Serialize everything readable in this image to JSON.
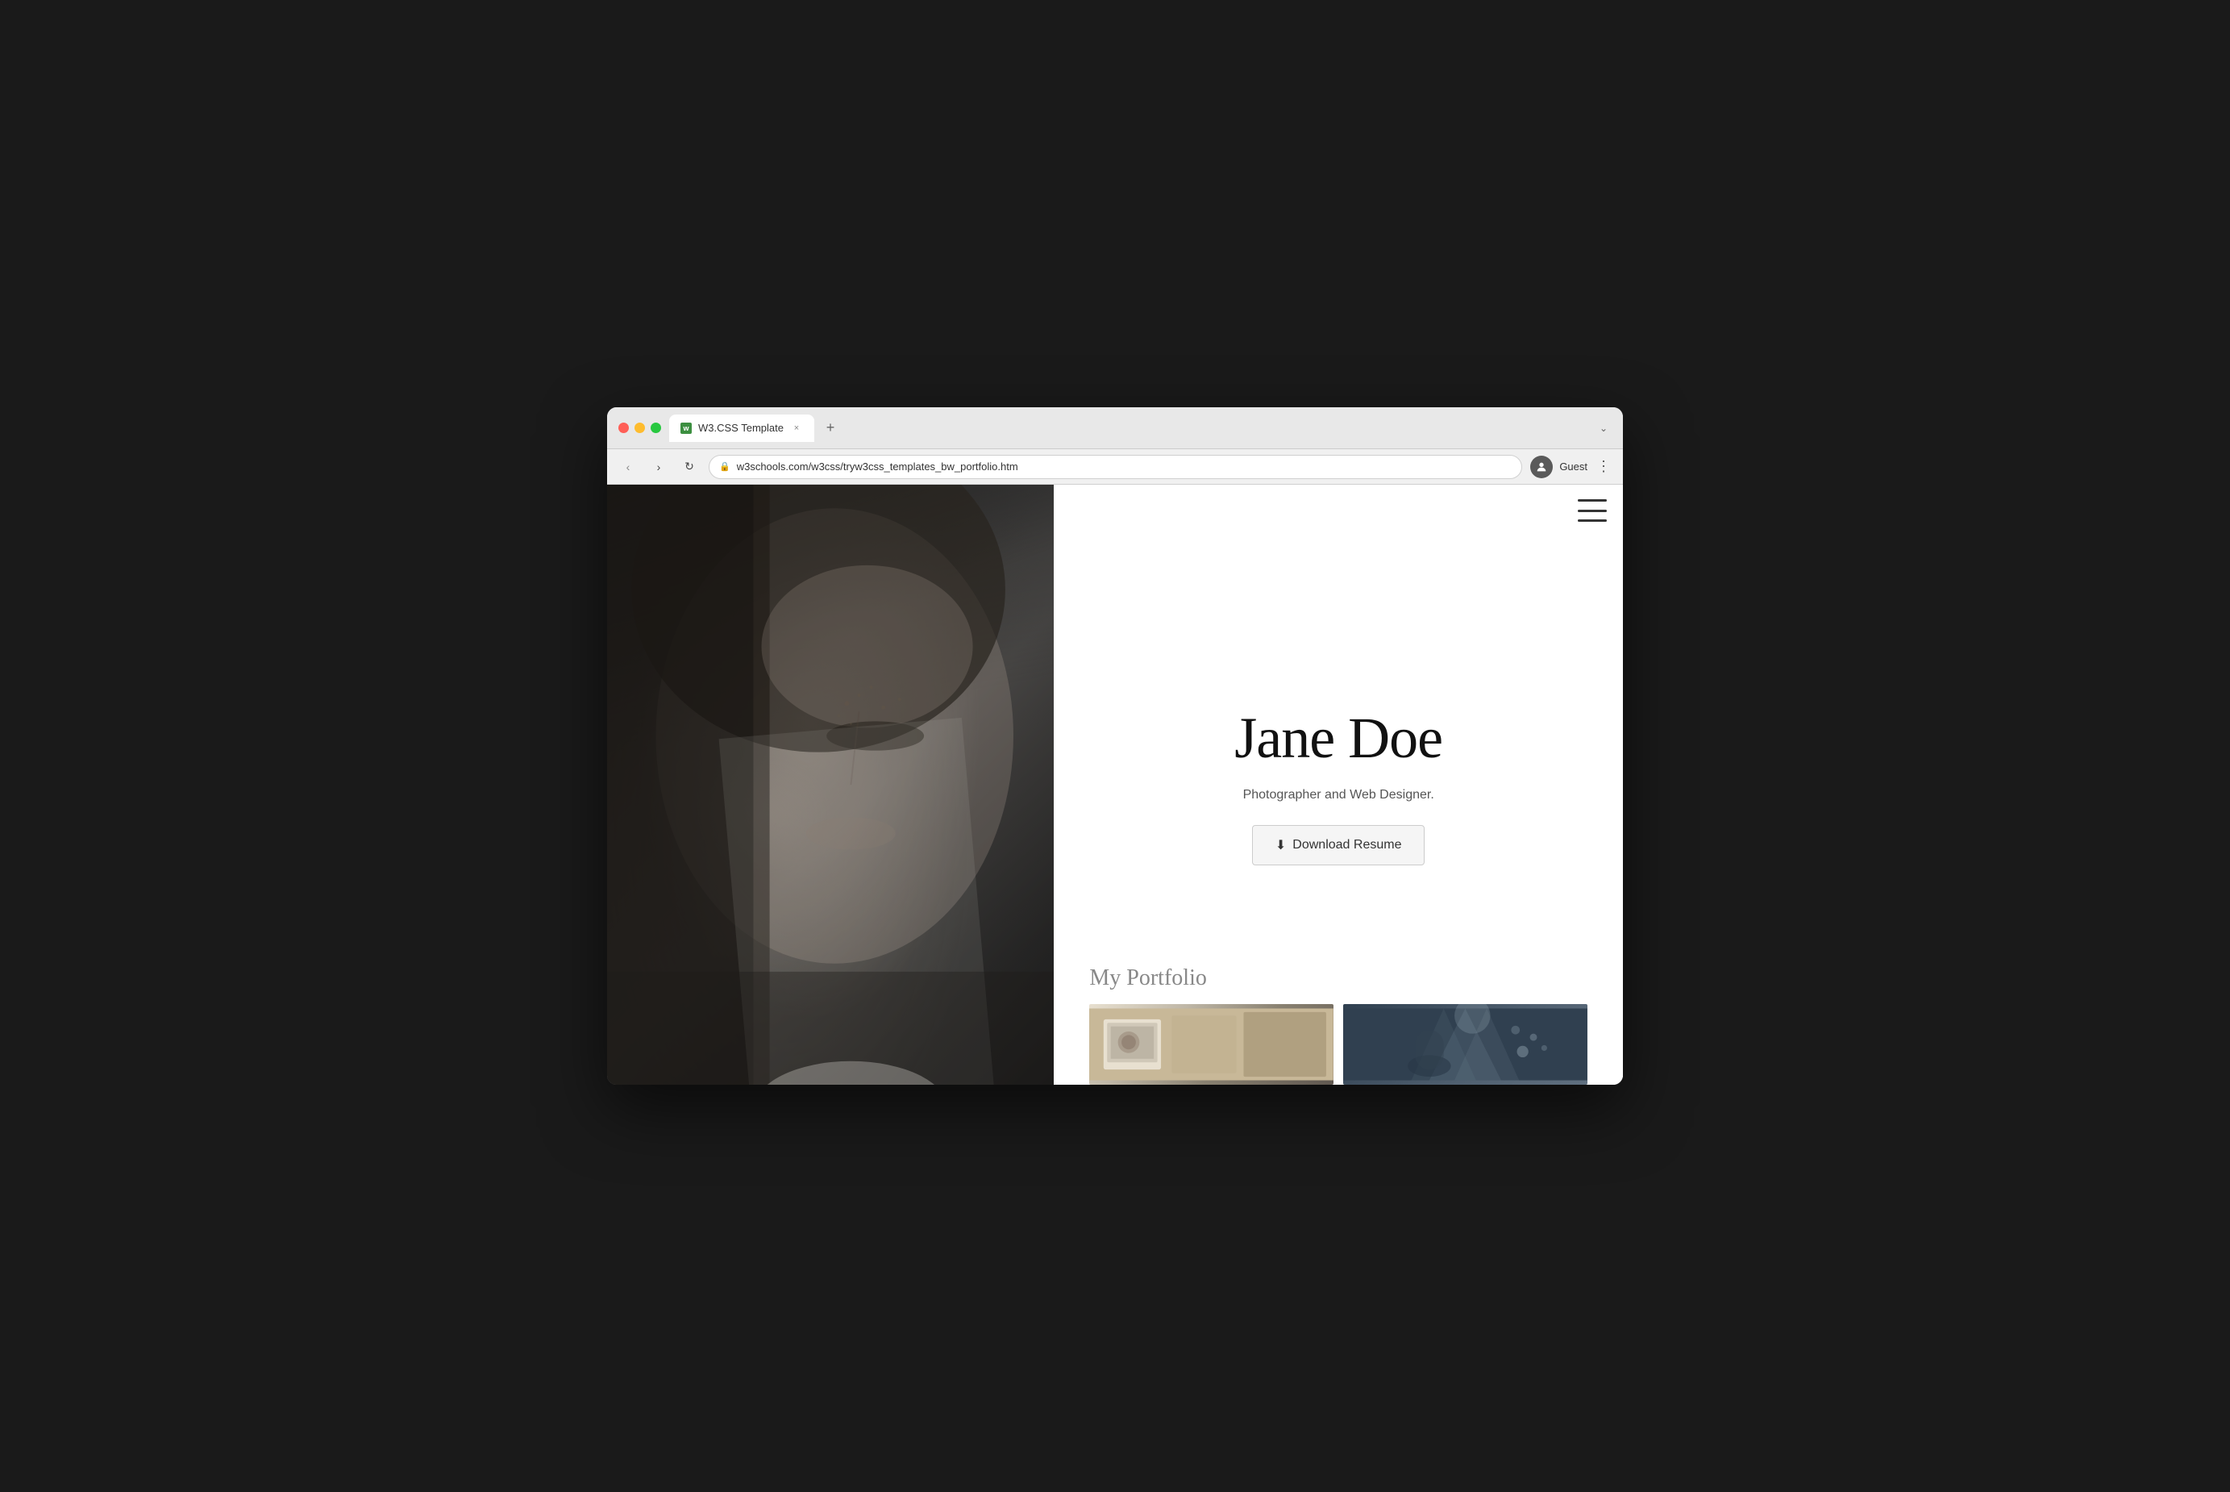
{
  "browser": {
    "tab_favicon": "w",
    "tab_title": "W3.CSS Template",
    "tab_close": "×",
    "tab_new": "+",
    "chevron": "⌄",
    "nav_back": "‹",
    "nav_forward": "›",
    "nav_refresh": "↻",
    "url": "w3schools.com/w3css/tryw3css_templates_bw_portfolio.htm",
    "lock_icon": "🔒",
    "user_icon": "person",
    "guest_label": "Guest",
    "more_icon": "⋮"
  },
  "page": {
    "hamburger_label": "menu",
    "hero_name": "Jane Doe",
    "hero_subtitle": "Photographer and Web Designer.",
    "download_button": "Download Resume",
    "download_icon": "⬇",
    "portfolio_title": "My Portfolio"
  }
}
